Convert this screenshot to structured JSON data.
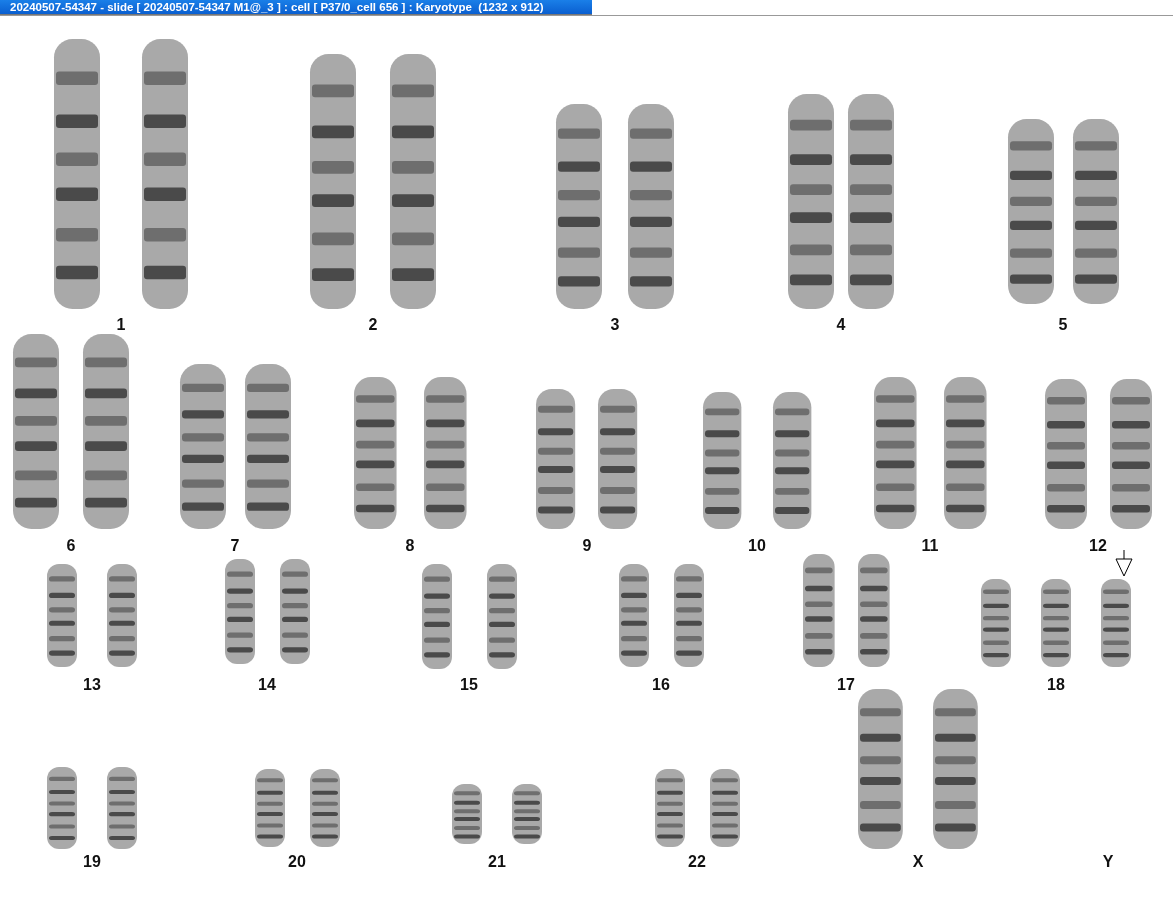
{
  "window": {
    "title": "20240507-54347 - slide [ 20240507-54347 M1@_3 ] : cell [ P37/0_cell 656 ] : Karyotype  (1232 x 912)"
  },
  "karyotype": [
    {
      "label": "1",
      "chromosomes": [
        {
          "marked": false
        },
        {
          "marked": false
        }
      ]
    },
    {
      "label": "2",
      "chromosomes": [
        {
          "marked": false
        },
        {
          "marked": false
        }
      ]
    },
    {
      "label": "3",
      "chromosomes": [
        {
          "marked": false
        },
        {
          "marked": false
        }
      ]
    },
    {
      "label": "4",
      "chromosomes": [
        {
          "marked": false
        },
        {
          "marked": false
        }
      ]
    },
    {
      "label": "5",
      "chromosomes": [
        {
          "marked": false
        },
        {
          "marked": false
        }
      ]
    },
    {
      "label": "6",
      "chromosomes": [
        {
          "marked": false
        },
        {
          "marked": false
        }
      ]
    },
    {
      "label": "7",
      "chromosomes": [
        {
          "marked": false
        },
        {
          "marked": false
        }
      ]
    },
    {
      "label": "8",
      "chromosomes": [
        {
          "marked": false
        },
        {
          "marked": false
        }
      ]
    },
    {
      "label": "9",
      "chromosomes": [
        {
          "marked": false
        },
        {
          "marked": false
        }
      ]
    },
    {
      "label": "10",
      "chromosomes": [
        {
          "marked": false
        },
        {
          "marked": false
        }
      ]
    },
    {
      "label": "11",
      "chromosomes": [
        {
          "marked": false
        },
        {
          "marked": false
        }
      ]
    },
    {
      "label": "12",
      "chromosomes": [
        {
          "marked": false
        },
        {
          "marked": false
        }
      ]
    },
    {
      "label": "13",
      "chromosomes": [
        {
          "marked": false
        },
        {
          "marked": false
        }
      ]
    },
    {
      "label": "14",
      "chromosomes": [
        {
          "marked": false
        },
        {
          "marked": false
        }
      ]
    },
    {
      "label": "15",
      "chromosomes": [
        {
          "marked": false
        },
        {
          "marked": false
        }
      ]
    },
    {
      "label": "16",
      "chromosomes": [
        {
          "marked": false
        },
        {
          "marked": false
        }
      ]
    },
    {
      "label": "17",
      "chromosomes": [
        {
          "marked": false
        },
        {
          "marked": false
        }
      ]
    },
    {
      "label": "18",
      "chromosomes": [
        {
          "marked": false
        },
        {
          "marked": false
        },
        {
          "marked": true
        }
      ]
    },
    {
      "label": "19",
      "chromosomes": [
        {
          "marked": false
        },
        {
          "marked": false
        }
      ]
    },
    {
      "label": "20",
      "chromosomes": [
        {
          "marked": false
        },
        {
          "marked": false
        }
      ]
    },
    {
      "label": "21",
      "chromosomes": [
        {
          "marked": false
        },
        {
          "marked": false
        }
      ]
    },
    {
      "label": "22",
      "chromosomes": [
        {
          "marked": false
        },
        {
          "marked": false
        }
      ]
    },
    {
      "label": "X",
      "chromosomes": [
        {
          "marked": false
        },
        {
          "marked": false
        }
      ]
    },
    {
      "label": "Y"
    }
  ]
}
